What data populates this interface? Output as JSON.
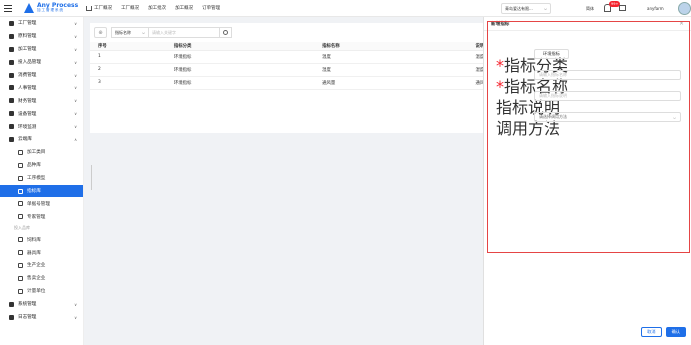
{
  "header": {
    "logo_en": "Any Process",
    "logo_cn": "加工管理系统",
    "nav": [
      "工厂概况",
      "工厂概况",
      "加工批次",
      "加工概况",
      "订单管理"
    ],
    "company": "青岛爱达有限...",
    "lang": "简体",
    "badge": "99+",
    "user": "anyfarm"
  },
  "sidebar": {
    "items": [
      {
        "label": "工厂管理",
        "kind": "top"
      },
      {
        "label": "原料管理",
        "kind": "top"
      },
      {
        "label": "加工管理",
        "kind": "top"
      },
      {
        "label": "投入品管理",
        "kind": "top"
      },
      {
        "label": "消费管理",
        "kind": "top"
      },
      {
        "label": "人事管理",
        "kind": "top"
      },
      {
        "label": "财务管理",
        "kind": "top"
      },
      {
        "label": "设备管理",
        "kind": "top"
      },
      {
        "label": "环境监测",
        "kind": "top"
      },
      {
        "label": "云端库",
        "kind": "top"
      },
      {
        "label": "加工类目",
        "kind": "sub"
      },
      {
        "label": "品种库",
        "kind": "sub"
      },
      {
        "label": "工序模型",
        "kind": "sub"
      },
      {
        "label": "指标库",
        "kind": "sub",
        "active": true
      },
      {
        "label": "单据号管理",
        "kind": "sub"
      },
      {
        "label": "专家管理",
        "kind": "sub"
      },
      {
        "label": "投入品库",
        "kind": "group"
      },
      {
        "label": "饲料库",
        "kind": "sub"
      },
      {
        "label": "器具库",
        "kind": "sub"
      },
      {
        "label": "生产企业",
        "kind": "sub"
      },
      {
        "label": "售卖企业",
        "kind": "sub"
      },
      {
        "label": "计量单位",
        "kind": "sub"
      },
      {
        "label": "系统管理",
        "kind": "top"
      },
      {
        "label": "日志管理",
        "kind": "top"
      }
    ]
  },
  "toolbar": {
    "select_value": "指标名称",
    "search_placeholder": "请输入关键字"
  },
  "table": {
    "headers": [
      "序号",
      "指标分类",
      "指标名称",
      "说明"
    ],
    "rows": [
      [
        "1",
        "环境指标",
        "温度",
        "温度"
      ],
      [
        "2",
        "环境指标",
        "湿度",
        "湿度"
      ],
      [
        "3",
        "环境指标",
        "通风量",
        "通风量"
      ]
    ]
  },
  "drawer": {
    "title": "新增指标",
    "close": "×",
    "fields": {
      "category_label": "指标分类",
      "category_value": "环境指标",
      "name_label": "指标名称",
      "name_placeholder": "请输入指标名称",
      "desc_label": "指标说明",
      "desc_placeholder": "请输入指标说明",
      "method_label": "调用方法",
      "method_placeholder": "请选择调用方法"
    },
    "cancel": "取消",
    "confirm": "确认"
  },
  "colors": {
    "accent": "#1f6fe8",
    "frame": "#e54545"
  }
}
